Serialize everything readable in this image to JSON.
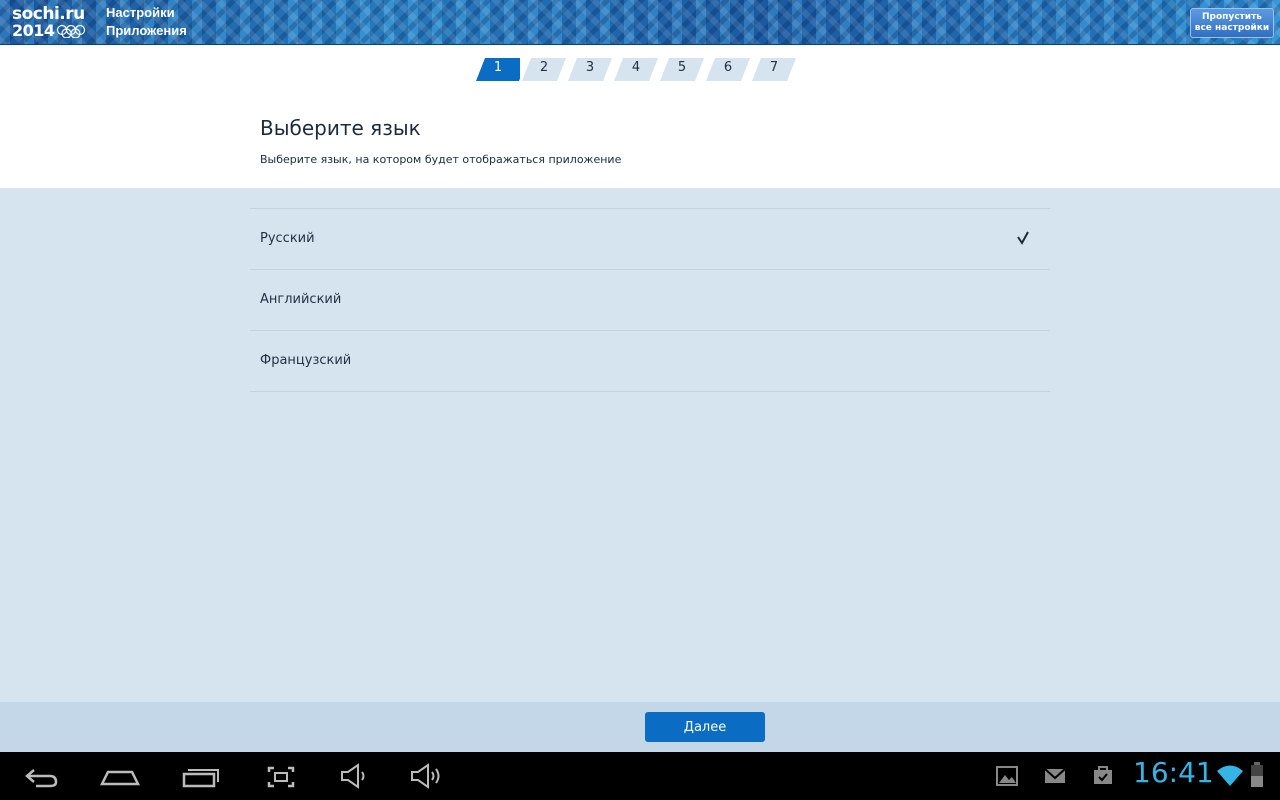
{
  "header": {
    "logo_line1": "sochi.ru",
    "logo_line2": "2014",
    "title_line1": "Настройки",
    "title_line2": "Приложения",
    "skip_line1": "Пропустить",
    "skip_line2": "все настройки"
  },
  "steps": [
    {
      "label": "1",
      "active": true
    },
    {
      "label": "2",
      "active": false
    },
    {
      "label": "3",
      "active": false
    },
    {
      "label": "4",
      "active": false
    },
    {
      "label": "5",
      "active": false
    },
    {
      "label": "6",
      "active": false
    },
    {
      "label": "7",
      "active": false
    }
  ],
  "main": {
    "title": "Выберите язык",
    "subtitle": "Выберите язык, на котором будет отображаться приложение",
    "languages": [
      {
        "label": "Русский",
        "selected": true
      },
      {
        "label": "Английский",
        "selected": false
      },
      {
        "label": "Французский",
        "selected": false
      }
    ]
  },
  "footer": {
    "next_label": "Далее"
  },
  "system_bar": {
    "clock": "16:41",
    "nav_icons": [
      "back-icon",
      "home-icon",
      "recent-apps-icon",
      "screenshot-icon",
      "volume-down-icon",
      "volume-up-icon"
    ],
    "status_icons": [
      "gallery-notification-icon",
      "gmail-notification-icon",
      "market-notification-icon",
      "wifi-icon",
      "battery-icon"
    ]
  },
  "colors": {
    "accent": "#0a6cc2",
    "background": "#d6e4ef",
    "step_inactive": "#d6e4ef",
    "clock": "#34b5e5"
  }
}
